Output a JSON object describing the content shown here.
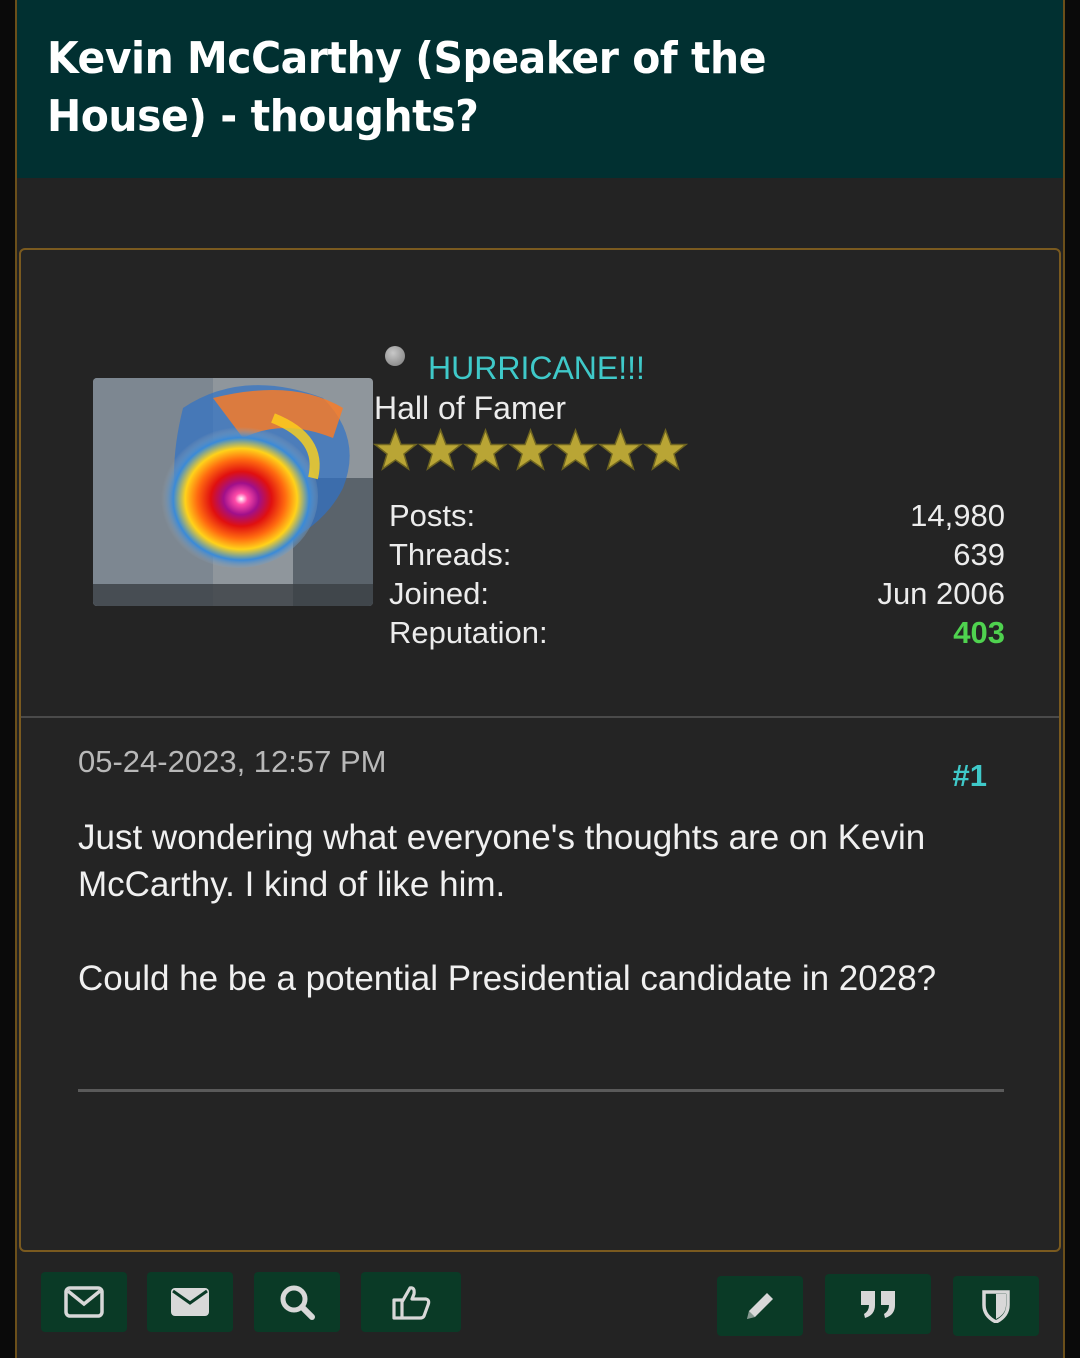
{
  "thread": {
    "title": "Kevin McCarthy (Speaker of the House) - thoughts?"
  },
  "user": {
    "name": "HURRICANE!!!",
    "title": "Hall of Famer",
    "stars": 7,
    "online_status": "offline",
    "avatar_icon": "hurricane-satellite-image",
    "stats": [
      {
        "label": "Posts:",
        "value": "14,980"
      },
      {
        "label": "Threads:",
        "value": "639"
      },
      {
        "label": "Joined:",
        "value": "Jun 2006"
      },
      {
        "label": "Reputation:",
        "value": "403"
      }
    ]
  },
  "post": {
    "date": "05-24-2023, 12:57 PM",
    "number": "#1",
    "paragraphs": [
      "Just wondering what everyone's thoughts are on Kevin McCarthy.  I kind of like him.",
      "Could he be a potential Presidential candidate in 2028?"
    ]
  },
  "toolbar": {
    "buttons": [
      "private-message",
      "email",
      "search",
      "thumbs-up",
      "edit",
      "quote",
      "report"
    ]
  },
  "colors": {
    "header_bg": "#013031",
    "link": "#3fc9c9",
    "reputation": "#4fd24f",
    "button_bg": "#0a3a26",
    "border": "#7a5a1f"
  }
}
